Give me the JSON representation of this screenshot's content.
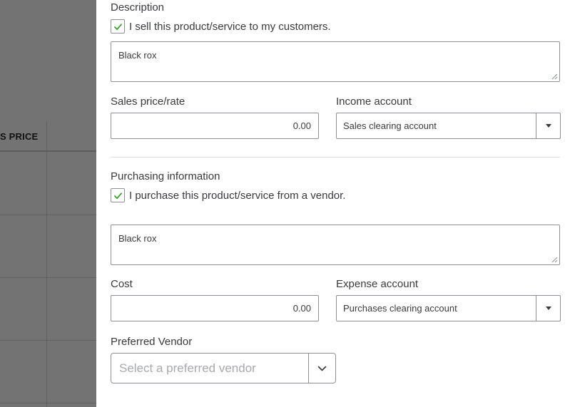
{
  "background_table": {
    "column_header": "S PRICE"
  },
  "description": {
    "heading": "Description",
    "sell_checkbox_label": "I sell this product/service to my customers.",
    "sell_checked": true,
    "text": "Black rox"
  },
  "sales": {
    "price_label": "Sales price/rate",
    "price_value": "0.00",
    "income_label": "Income account",
    "income_value": "Sales clearing account"
  },
  "purchasing": {
    "heading": "Purchasing information",
    "purchase_checkbox_label": "I purchase this product/service from a vendor.",
    "purchase_checked": true,
    "text": "Black rox",
    "cost_label": "Cost",
    "cost_value": "0.00",
    "expense_label": "Expense account",
    "expense_value": "Purchases clearing account",
    "vendor_label": "Preferred Vendor",
    "vendor_placeholder": "Select a preferred vendor"
  },
  "colors": {
    "checkmark": "#2ca01c",
    "overlay": "#737373",
    "border": "#8d9096",
    "text": "#393a3d"
  },
  "icons": {
    "checkbox_check": "check-icon",
    "dropdown_caret": "caret-down-icon",
    "vendor_chevron": "chevron-down-icon",
    "resize": "resize-grip-icon"
  }
}
